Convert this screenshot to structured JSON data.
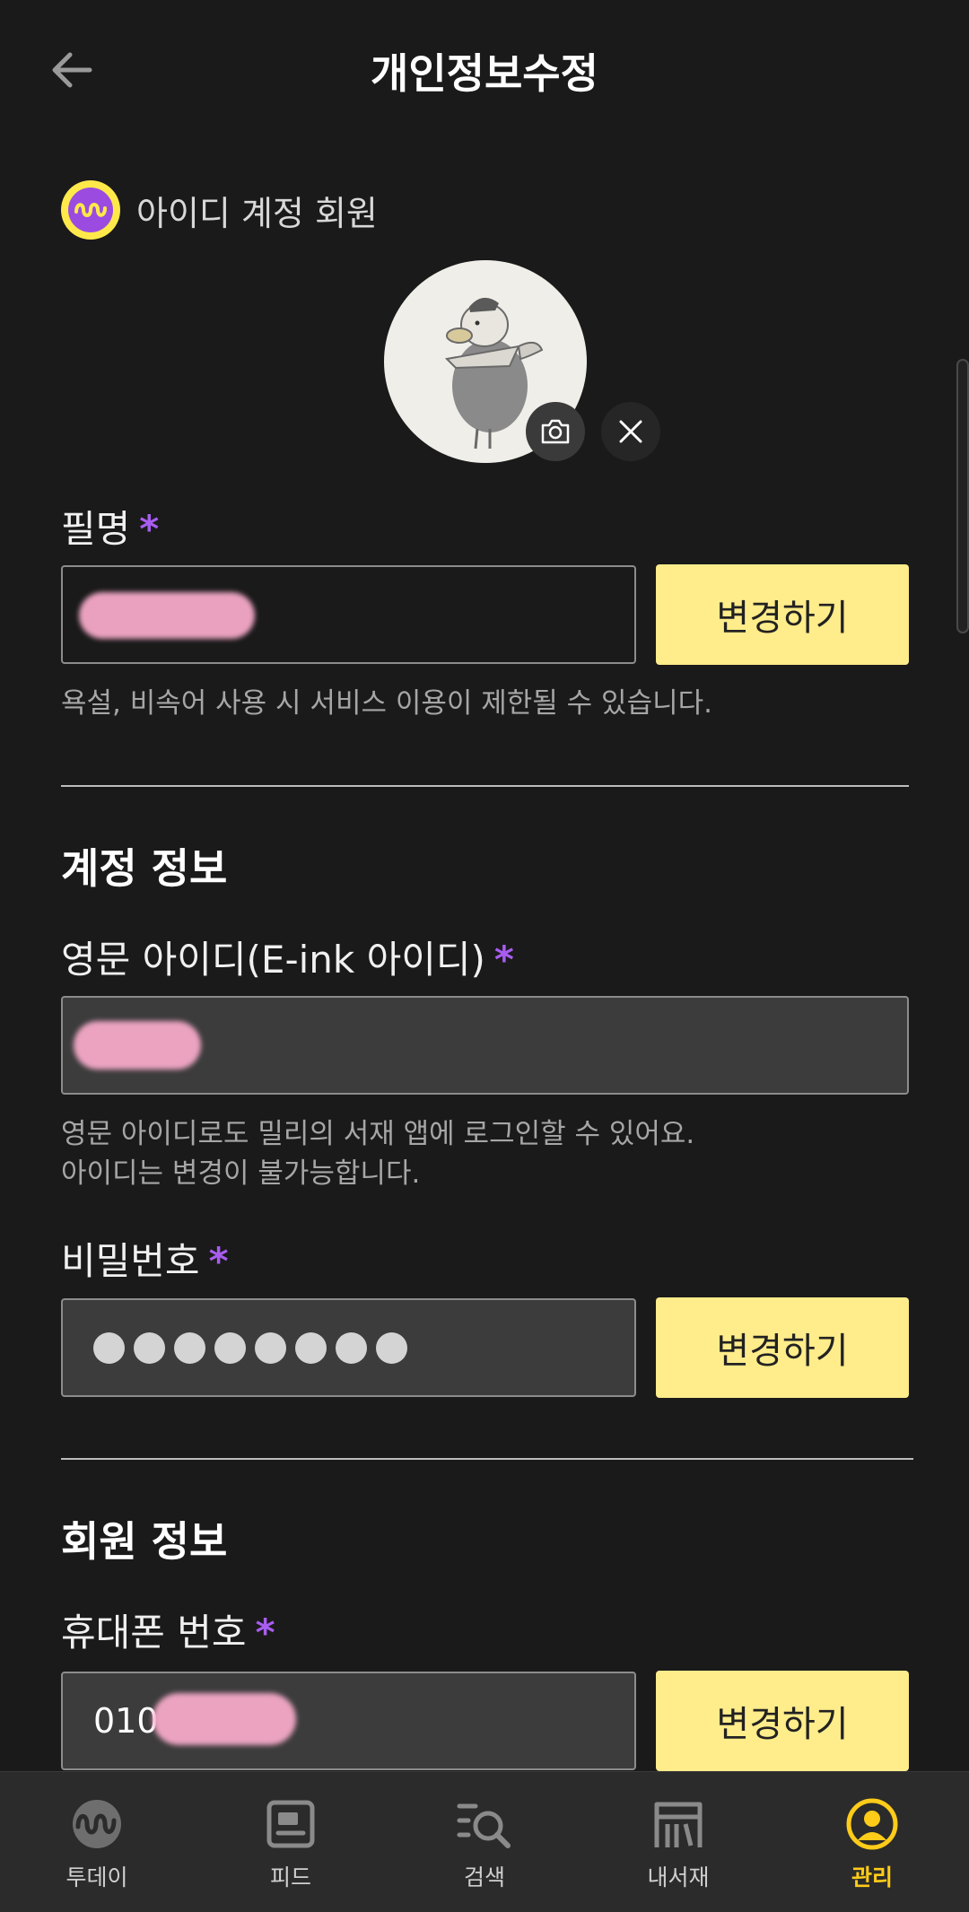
{
  "header": {
    "title": "개인정보수정"
  },
  "account": {
    "type_label": "아이디 계정 회원"
  },
  "pen_name": {
    "label": "필명",
    "required_mark": "*",
    "button_label": "변경하기",
    "help_text": "욕설, 비속어 사용 시 서비스 이용이 제한될 수 있습니다."
  },
  "account_info": {
    "section_title": "계정 정보",
    "english_id": {
      "label": "영문 아이디(E-ink 아이디)",
      "required_mark": "*",
      "help_line1": "영문 아이디로도 밀리의 서재 앱에 로그인할 수 있어요.",
      "help_line2": "아이디는 변경이 불가능합니다."
    },
    "password": {
      "label": "비밀번호",
      "required_mark": "*",
      "masked_length": 8,
      "button_label": "변경하기"
    }
  },
  "member_info": {
    "section_title": "회원 정보",
    "phone": {
      "label": "휴대폰 번호",
      "required_mark": "*",
      "value_prefix": "010",
      "button_label": "변경하기"
    }
  },
  "bottom_nav": {
    "items": [
      {
        "label": "투데이",
        "icon": "today-wave-icon",
        "active": false
      },
      {
        "label": "피드",
        "icon": "feed-icon",
        "active": false
      },
      {
        "label": "검색",
        "icon": "search-icon",
        "active": false
      },
      {
        "label": "내서재",
        "icon": "bookshelf-icon",
        "active": false
      },
      {
        "label": "관리",
        "icon": "profile-icon",
        "active": true
      }
    ]
  },
  "colors": {
    "background": "#1a1a1a",
    "accent_yellow": "#ffec8a",
    "required_purple": "#a85df0",
    "active_nav": "#ffcc19"
  }
}
